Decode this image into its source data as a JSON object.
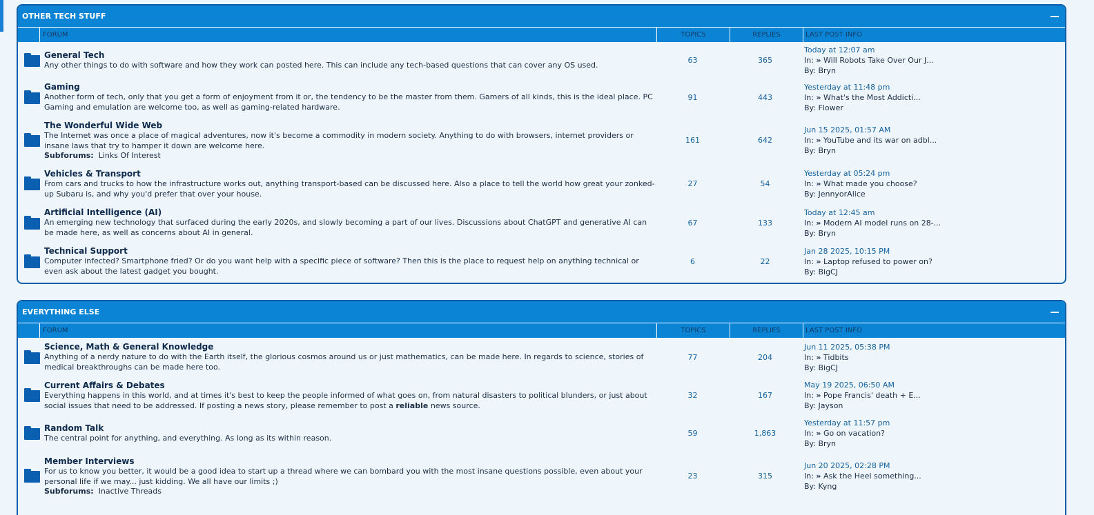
{
  "categories": [
    {
      "title": "OTHER TECH STUFF",
      "columns": {
        "forum": "FORUM",
        "topics": "TOPICS",
        "replies": "REPLIES",
        "last": "LAST POST INFO"
      },
      "forums": [
        {
          "title": "General Tech",
          "desc": "Any other things to do with software and how they work can posted here. This can include any tech-based questions that can cover any OS used.",
          "topics": "63",
          "replies": "365",
          "date": "Today at 12:07 am",
          "in_label": "In:",
          "thread": "Will Robots Take Over Our J...",
          "by_label": "By:",
          "user": "Bryn"
        },
        {
          "title": "Gaming",
          "desc": "Another form of tech, only that you get a form of enjoyment from it or, the tendency to be the master from them. Gamers of all kinds, this is the ideal place. PC Gaming and emulation are welcome too, as well as gaming-related hardware.",
          "topics": "91",
          "replies": "443",
          "date": "Yesterday at 11:48 pm",
          "in_label": "In:",
          "thread": "What's the Most Addicti...",
          "by_label": "By:",
          "user": "Flower"
        },
        {
          "title": "The Wonderful Wide Web",
          "desc": "The Internet was once a place of magical adventures, now it's become a commodity in modern society. Anything to do with browsers, internet providers or insane laws that try to hamper it down are welcome here.",
          "subforums_label": "Subforums:",
          "subforums": "Links Of Interest",
          "topics": "161",
          "replies": "642",
          "date": "Jun 15 2025, 01:57 AM",
          "in_label": "In:",
          "thread": "YouTube and its war on adbl...",
          "by_label": "By:",
          "user": "Bryn"
        },
        {
          "title": "Vehicles & Transport",
          "desc": "From cars and trucks to how the infrastructure works out, anything transport-based can be discussed here. Also a place to tell the world how great your zonked-up Subaru is, and why you'd prefer that over your house.",
          "topics": "27",
          "replies": "54",
          "date": "Yesterday at 05:24 pm",
          "in_label": "In:",
          "thread": "What made you choose?",
          "by_label": "By:",
          "user": "JennyorAlice"
        },
        {
          "title": "Artificial Intelligence (AI)",
          "desc": "An emerging new technology that surfaced during the early 2020s, and slowly becoming a part of our lives. Discussions about ChatGPT and generative AI can be made here, as well as concerns about AI in general.",
          "topics": "67",
          "replies": "133",
          "date": "Today at 12:45 am",
          "in_label": "In:",
          "thread": "Modern AI model runs on 28-...",
          "by_label": "By:",
          "user": "Bryn"
        },
        {
          "title": "Technical Support",
          "desc": "Computer infected? Smartphone fried? Or do you want help with a specific piece of software? Then this is the place to request help on anything technical or even ask about the latest gadget you bought.",
          "topics": "6",
          "replies": "22",
          "date": "Jan 28 2025, 10:15 PM",
          "in_label": "In:",
          "thread": "Laptop refused to power on?",
          "by_label": "By:",
          "user": "BigCJ"
        }
      ]
    },
    {
      "title": "EVERYTHING ELSE",
      "columns": {
        "forum": "FORUM",
        "topics": "TOPICS",
        "replies": "REPLIES",
        "last": "LAST POST INFO"
      },
      "forums": [
        {
          "title": "Science, Math & General Knowledge",
          "desc": "Anything of a nerdy nature to do with the Earth itself, the glorious cosmos around us or just mathematics, can be made here. In regards to science, stories of medical breakthroughs can be made here too.",
          "topics": "77",
          "replies": "204",
          "date": "Jun 11 2025, 05:38 PM",
          "in_label": "In:",
          "thread": "Tidbits",
          "by_label": "By:",
          "user": "BigCJ"
        },
        {
          "title": "Current Affairs & Debates",
          "desc_a": "Everything happens in this world, and at times it's best to keep the people informed of what goes on, from natural disasters to political blunders, or just about social issues that need to be addressed. If posting a news story, please remember to post a ",
          "desc_bold": "reliable",
          "desc_b": " news source.",
          "topics": "32",
          "replies": "167",
          "date": "May 19 2025, 06:50 AM",
          "in_label": "In:",
          "thread": "Pope Francis' death + E...",
          "by_label": "By:",
          "user": "Jayson"
        },
        {
          "title": "Random Talk",
          "desc": "The central point for anything, and everything. As long as its within reason.",
          "topics": "59",
          "replies": "1,863",
          "date": "Yesterday at 11:57 pm",
          "in_label": "In:",
          "thread": "Go on vacation?",
          "by_label": "By:",
          "user": "Bryn"
        },
        {
          "title": "Member Interviews",
          "desc": "For us to know you better, it would be a good idea to start up a thread where we can bombard you with the most insane questions possible, even about your personal life if we may... just kidding. We all have our limits ;)",
          "subforums_label": "Subforums:",
          "subforums": "Inactive Threads",
          "topics": "23",
          "replies": "315",
          "date": "Jun 20 2025, 02:28 PM",
          "in_label": "In:",
          "thread": "Ask the Heel something...",
          "by_label": "By:",
          "user": "Kyng"
        }
      ]
    }
  ]
}
